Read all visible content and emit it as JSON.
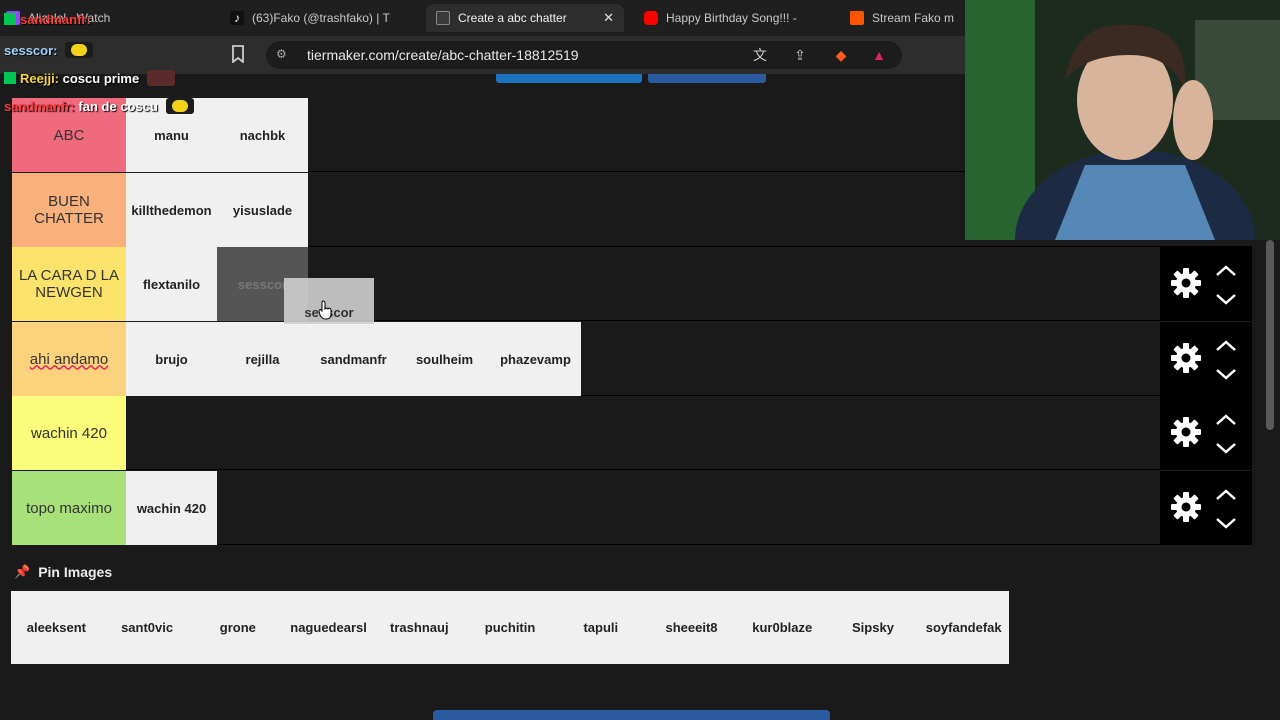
{
  "tabs": [
    {
      "title": "Aliaslol - Watch",
      "icon": "twitch-icon"
    },
    {
      "title": "(63)Fako (@trashfako) | T",
      "icon": "tiktok-icon"
    },
    {
      "title": "Create a abc chatter",
      "icon": "tiermaker-icon",
      "active": true
    },
    {
      "title": "Happy Birthday Song!!! -",
      "icon": "youtube-icon"
    },
    {
      "title": "Stream Fako m",
      "icon": "soundcloud-icon"
    }
  ],
  "address": {
    "url": "tiermaker.com/create/abc-chatter-18812519"
  },
  "chat": [
    {
      "user": "sandmanfr:",
      "message": "",
      "user_color": "#ff3b3b"
    },
    {
      "user": "sesscor:",
      "message": "",
      "user_color": "#9fd1ff"
    },
    {
      "user": "Reejji:",
      "message": "coscu prime",
      "user_color": "#f5d442"
    },
    {
      "user": "sandmanfr:",
      "message": "fan de coscu",
      "user_color": "#ff3b3b"
    }
  ],
  "tiers": [
    {
      "label": "ABC",
      "color": "#f06a7e",
      "items": [
        "manu",
        "nachbk"
      ]
    },
    {
      "label": "BUEN CHATTER",
      "color": "#f9b07a",
      "items": [
        "killthedemon",
        "yisuslade"
      ]
    },
    {
      "label": "LA CARA D LA NEWGEN",
      "color": "#fbe26a",
      "items": [
        "flextanilo",
        "sesscor"
      ]
    },
    {
      "label": "ahi andamo",
      "color": "#fcd27c",
      "items": [
        "brujo",
        "rejilla",
        "sandmanfr",
        "soulheim",
        "phazevamp"
      ]
    },
    {
      "label": "wachin 420",
      "color": "#fcfc7c",
      "items": []
    },
    {
      "label": "topo maximo",
      "color": "#a8e07a",
      "items": [
        "wachin 420"
      ]
    }
  ],
  "dragging": {
    "label": "sesscor"
  },
  "pin": {
    "label": "Pin Images"
  },
  "pool": [
    "aleeksent",
    "sant0vic",
    "grone",
    "naguedearsl",
    "trashnauj",
    "puchitin",
    "tapuli",
    "sheeeit8",
    "kur0blaze",
    "Sipsky",
    "soyfandefak"
  ],
  "colors": {
    "accent": "#1e73be",
    "pin": "#e0245e"
  }
}
